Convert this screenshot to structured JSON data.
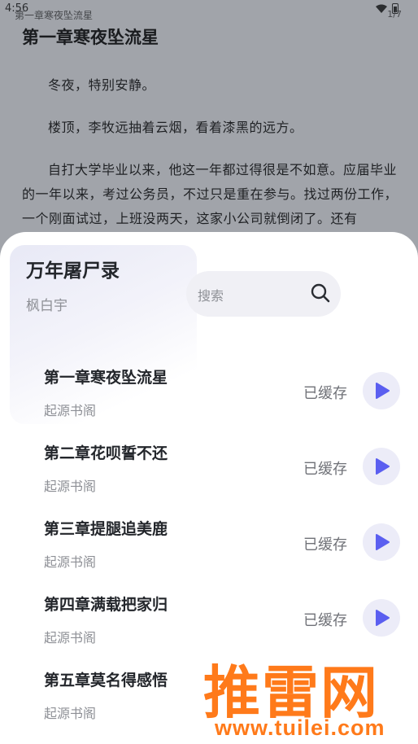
{
  "status_bar": {
    "time": "4:56",
    "title": "第一章寒夜坠流星",
    "page_indicator": "1/7"
  },
  "reader": {
    "chapter_title": "第一章寒夜坠流星",
    "paragraphs": [
      "冬夜，特别安静。",
      "楼顶，李牧远抽着云烟，看着漆黑的远方。",
      "自打大学毕业以来，他这一年都过得很是不如意。应届毕业的一年以来，考过公务员，不过只是重在参与。找过两份工作，一个刚面试过，上班没两天，这家小公司就倒闭了。还有"
    ]
  },
  "sheet": {
    "book_title": "万年屠尸录",
    "author": "枫白宇",
    "search_placeholder": "搜索",
    "chapters": [
      {
        "name": "第一章寒夜坠流星",
        "source": "起源书阁",
        "status": "已缓存"
      },
      {
        "name": "第二章花呗誓不还",
        "source": "起源书阁",
        "status": "已缓存"
      },
      {
        "name": "第三章提腿追美鹿",
        "source": "起源书阁",
        "status": "已缓存"
      },
      {
        "name": "第四章满载把家归",
        "source": "起源书阁",
        "status": "已缓存"
      },
      {
        "name": "第五章莫名得感悟",
        "source": "起源书阁",
        "status": ""
      }
    ]
  },
  "watermark": {
    "logo_text": "推雷网",
    "url": "www.tuilei.com"
  },
  "colors": {
    "accent": "#5b5ff0",
    "play_bg": "#ececf8",
    "overlay": "#a1a4aa",
    "watermark": "#ff7a1a"
  }
}
